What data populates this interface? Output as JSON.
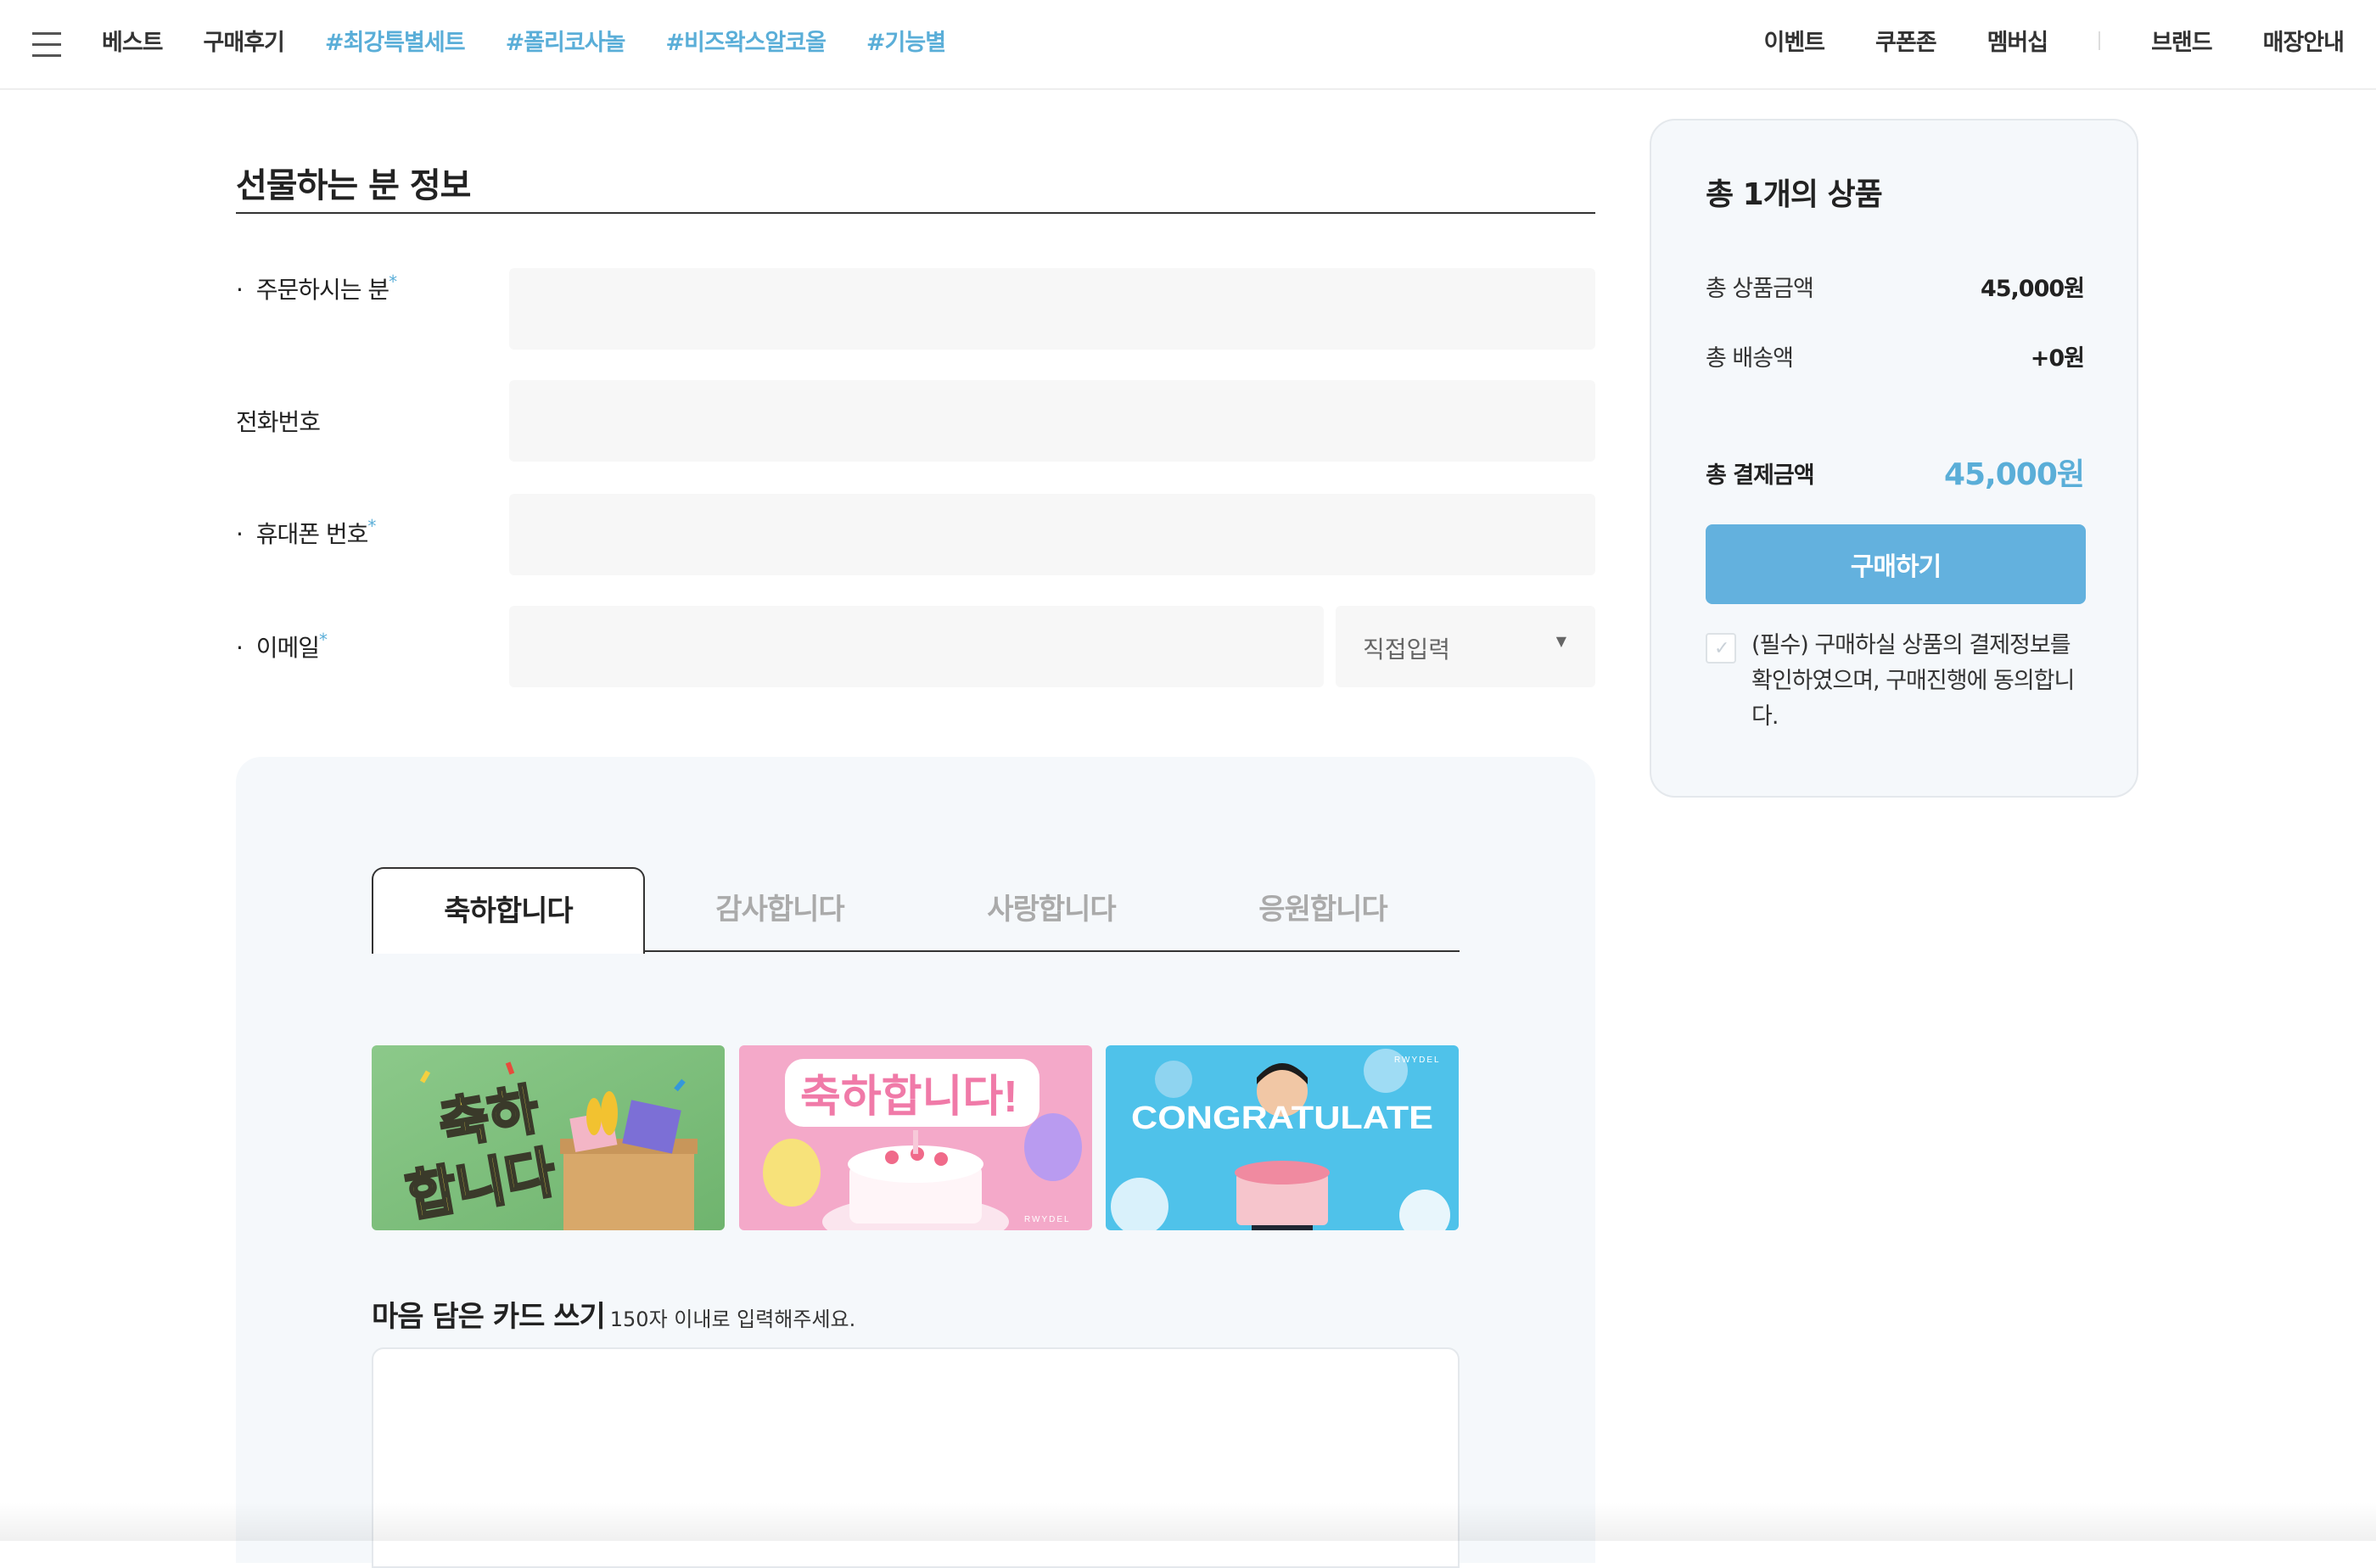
{
  "nav": {
    "left": [
      "베스트",
      "구매후기"
    ],
    "tags": [
      "#최강특별세트",
      "#폴리코사놀",
      "#비즈왁스알코올",
      "#기능별"
    ],
    "right": [
      "이벤트",
      "쿠폰존",
      "멤버십",
      "브랜드",
      "매장안내"
    ]
  },
  "giver": {
    "title": "선물하는 분 정보",
    "fields": {
      "orderer": {
        "label": "주문하시는 분",
        "required_mark": "*"
      },
      "phone": {
        "label": "전화번호"
      },
      "mobile": {
        "label": "휴대폰 번호",
        "required_mark": "*"
      },
      "email": {
        "label": "이메일",
        "required_mark": "*",
        "domain_select": "직접입력"
      }
    }
  },
  "card": {
    "tabs": [
      "축하합니다",
      "감사합니다",
      "사랑합니다",
      "응원합니다"
    ],
    "active_tab": "축하합니다",
    "thumbnails": {
      "t1": {
        "line1": "축하",
        "line2": "합니다"
      },
      "t2": {
        "text": "축하합니다!",
        "brand": "RWYDEL"
      },
      "t3": {
        "text": "CONGRATULATE",
        "brand": "RWYDEL"
      }
    },
    "heading": "마음 담은 카드 쓰기",
    "hint": "150자 이내로 입력해주세요."
  },
  "summary": {
    "title": "총 1개의 상품",
    "product_total_label": "총 상품금액",
    "product_total_value": "45,000원",
    "shipping_label": "총 배송액",
    "shipping_value": "+0원",
    "payment_label": "총 결제금액",
    "payment_value": "45,000원",
    "buy_button": "구매하기",
    "agree_text": "(필수) 구매하실 상품의 결제정보를 확인하였으며, 구매진행에 동의합니다."
  },
  "colors": {
    "accent": "#5aaed8",
    "button": "#63b1de",
    "panel": "#f5f8fb"
  }
}
